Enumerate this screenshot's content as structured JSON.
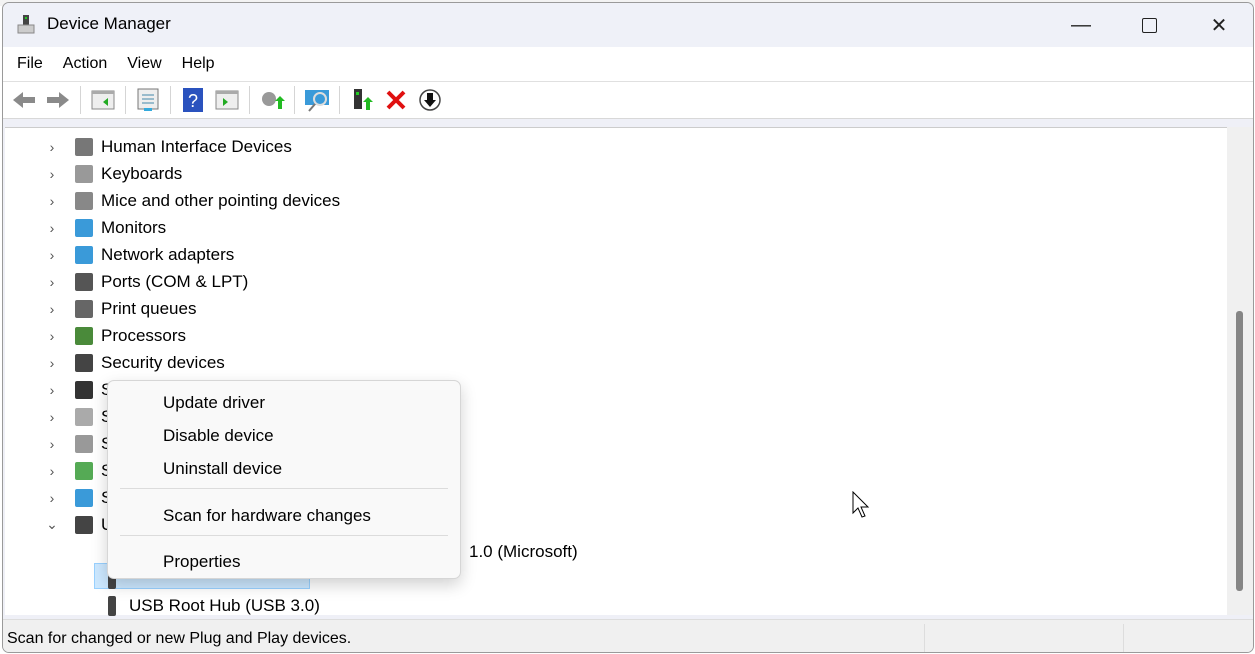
{
  "window": {
    "title": "Device Manager"
  },
  "menubar": [
    "File",
    "Action",
    "View",
    "Help"
  ],
  "toolbar": [
    "back-icon",
    "forward-icon",
    "show-hide-console-tree-icon",
    "properties-icon",
    "help-icon",
    "action-pane-icon",
    "update-driver-icon",
    "scan-hardware-icon",
    "enable-device-icon",
    "uninstall-icon",
    "disable-device-icon"
  ],
  "tree": [
    {
      "label": "Human Interface Devices",
      "icon": "hid-icon"
    },
    {
      "label": "Keyboards",
      "icon": "keyboard-icon"
    },
    {
      "label": "Mice and other pointing devices",
      "icon": "mouse-icon"
    },
    {
      "label": "Monitors",
      "icon": "monitor-icon"
    },
    {
      "label": "Network adapters",
      "icon": "network-icon"
    },
    {
      "label": "Ports (COM & LPT)",
      "icon": "port-icon"
    },
    {
      "label": "Print queues",
      "icon": "printer-icon"
    },
    {
      "label": "Processors",
      "icon": "processor-icon"
    },
    {
      "label": "Security devices",
      "icon": "security-icon"
    },
    {
      "label": "S",
      "icon": "software-device-icon"
    },
    {
      "label": "S",
      "icon": "storage-icon"
    },
    {
      "label": "S",
      "icon": "sound-icon"
    },
    {
      "label": "S",
      "icon": "storage-controller-icon"
    },
    {
      "label": "S",
      "icon": "system-device-icon"
    },
    {
      "label": "U",
      "icon": "usb-icon",
      "expanded": true
    }
  ],
  "children": [
    {
      "label": "1.0 (Microsoft)"
    },
    {
      "label": "",
      "selected": true
    },
    {
      "label": "USB Root Hub (USB 3.0)"
    }
  ],
  "context_menu": [
    "Update driver",
    "Disable device",
    "Uninstall device",
    "Scan for hardware changes",
    "Properties"
  ],
  "status": "Scan for changed or new Plug and Play devices."
}
